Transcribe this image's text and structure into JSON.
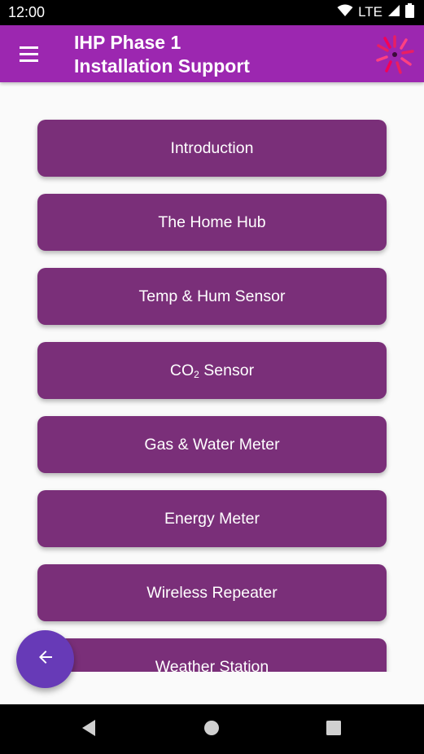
{
  "status_bar": {
    "time": "12:00",
    "network": "LTE",
    "icons": [
      "wifi-icon",
      "signal-icon",
      "battery-icon"
    ]
  },
  "app_bar": {
    "title_line1": "IHP Phase 1",
    "title_line2": "Installation Support",
    "menu_icon": "hamburger-menu-icon",
    "logo": "sunburst-logo",
    "color": "#9c27b0"
  },
  "menu": {
    "button_color": "#7a2f79",
    "items": [
      {
        "label": "Introduction"
      },
      {
        "label": "The Home Hub"
      },
      {
        "label": "Temp & Hum Sensor"
      },
      {
        "label": "CO",
        "sub": "2",
        "suffix": " Sensor"
      },
      {
        "label": "Gas & Water Meter"
      },
      {
        "label": "Energy Meter"
      },
      {
        "label": "Wireless Repeater"
      },
      {
        "label": "Weather Station"
      }
    ]
  },
  "fab": {
    "icon": "arrow-left-icon",
    "color": "#673ab7"
  },
  "nav_bar": {
    "icons": [
      "back-triangle-icon",
      "home-circle-icon",
      "recents-square-icon"
    ]
  }
}
